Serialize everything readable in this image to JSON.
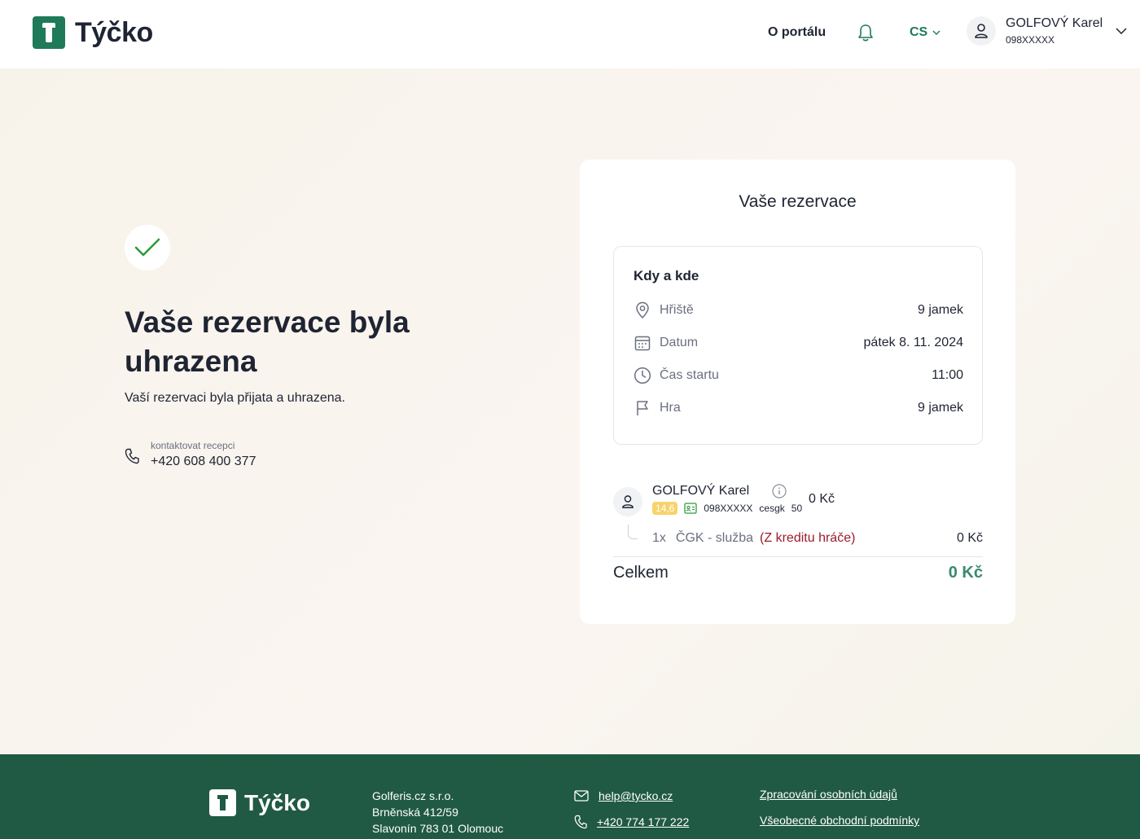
{
  "header": {
    "logo_text": "Týčko",
    "nav_portal": "O portálu",
    "lang": "CS",
    "user_name": "GOLFOVÝ Karel",
    "user_id": "098XXXXX"
  },
  "hero": {
    "title": "Vaše rezervace byla uhrazena",
    "subtitle": "Vaší rezervaci byla přijata a uhrazena.",
    "contact_label": "kontaktovat recepci",
    "contact_phone": "+420 608 400 377"
  },
  "card": {
    "title": "Vaše rezervace",
    "where_title": "Kdy a kde",
    "rows": [
      {
        "label": "Hřiště",
        "value": "9 jamek",
        "icon": "location-pin-icon"
      },
      {
        "label": "Datum",
        "value": "pátek 8. 11. 2024",
        "icon": "calendar-icon"
      },
      {
        "label": "Čas startu",
        "value": "11:00",
        "icon": "clock-icon"
      },
      {
        "label": "Hra",
        "value": "9 jamek",
        "icon": "flag-icon"
      }
    ],
    "player": {
      "name": "GOLFOVÝ Karel",
      "hcp": "14,6",
      "member_id": "098XXXXX",
      "club": "cesgk",
      "club_num": "50",
      "price": "0 Kč"
    },
    "service": {
      "qty": "1x",
      "name": "ČGK - služba",
      "credit_note": "(Z kreditu hráče)",
      "price": "0 Kč"
    },
    "total_label": "Celkem",
    "total_value": "0 Kč"
  },
  "footer": {
    "logo_text": "Týčko",
    "company": "Golferis.cz s.r.o.",
    "street": "Brněnská 412/59",
    "city": "Slavonín 783 01 Olomouc",
    "email": "help@tycko.cz",
    "phone": "+420 774 177 222",
    "link_privacy": "Zpracování osobních údajů",
    "link_terms": "Všeobecné obchodní podmínky"
  },
  "colors": {
    "brand_green": "#1f7a5a",
    "footer_green": "#205a44",
    "total_green": "#3a8a6e",
    "credit_red": "#9a1c2b",
    "check_green": "#2e9b3a"
  }
}
